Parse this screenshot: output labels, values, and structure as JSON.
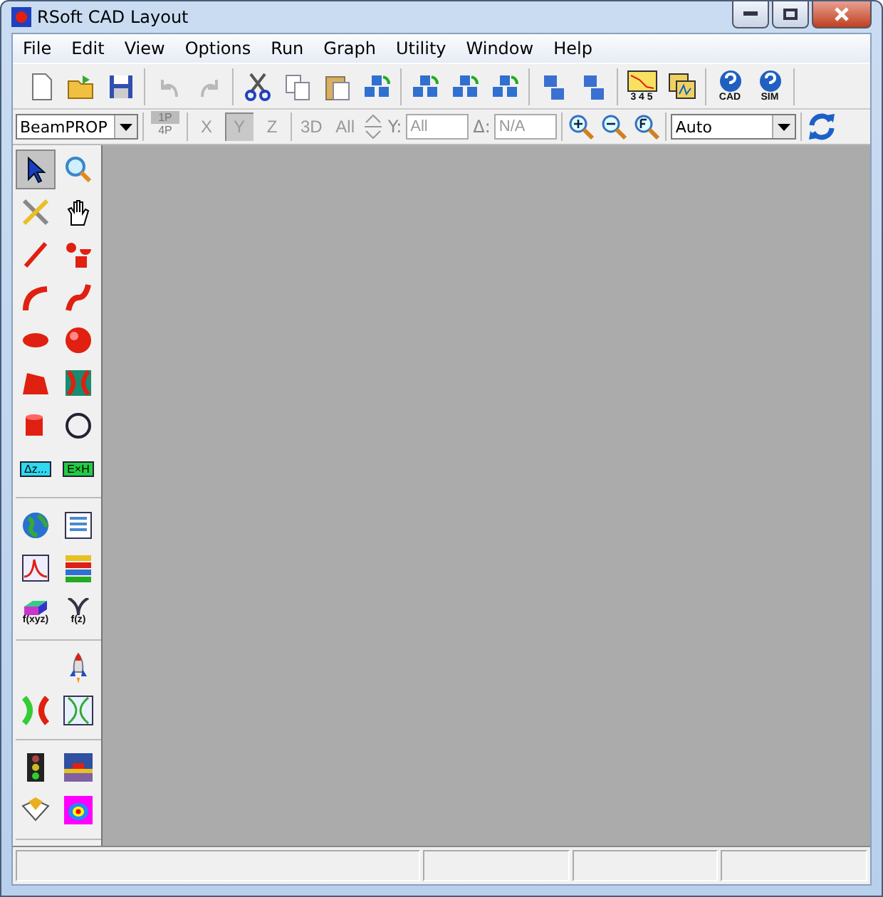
{
  "window": {
    "title": "RSoft CAD Layout"
  },
  "menu": [
    {
      "label": "File"
    },
    {
      "label": "Edit"
    },
    {
      "label": "View"
    },
    {
      "label": "Options"
    },
    {
      "label": "Run"
    },
    {
      "label": "Graph"
    },
    {
      "label": "Utility"
    },
    {
      "label": "Window"
    },
    {
      "label": "Help"
    }
  ],
  "toolbar": [
    [
      {
        "kind": "new",
        "disabled": false
      },
      {
        "kind": "open",
        "disabled": false
      },
      {
        "kind": "save",
        "disabled": false
      }
    ],
    [
      {
        "kind": "undo",
        "disabled": true
      },
      {
        "kind": "redo",
        "disabled": true
      }
    ],
    [
      {
        "kind": "cut",
        "disabled": false
      },
      {
        "kind": "copy",
        "disabled": false
      },
      {
        "kind": "paste",
        "disabled": false
      },
      {
        "kind": "cubes",
        "disabled": false
      }
    ],
    [
      {
        "kind": "cubes",
        "disabled": false
      },
      {
        "kind": "cubes",
        "disabled": false
      },
      {
        "kind": "cubes",
        "disabled": false
      }
    ],
    [
      {
        "kind": "stack",
        "disabled": false
      },
      {
        "kind": "stack",
        "disabled": false
      }
    ],
    [
      {
        "kind": "chart",
        "disabled": false,
        "label": "3 4 5"
      },
      {
        "kind": "windows",
        "disabled": false
      }
    ],
    [
      {
        "kind": "help",
        "disabled": false,
        "label": "CAD"
      },
      {
        "kind": "help",
        "disabled": false,
        "label": "SIM"
      }
    ]
  ],
  "options_bar": {
    "program": "BeamPROP",
    "view_top": "1P",
    "view_bottom": "4P",
    "axes": [
      {
        "label": "X",
        "selected": false
      },
      {
        "label": "Y",
        "selected": true
      },
      {
        "label": "Z",
        "selected": false
      },
      {
        "label": "3D",
        "selected": false
      },
      {
        "label": "All",
        "selected": false
      }
    ],
    "y_label": "Y:",
    "y_value": "All",
    "delta_label": "Δ:",
    "delta_value": "N/A",
    "zoom": "Auto"
  },
  "palette": [
    [
      {
        "kind": "pointer",
        "selected": true
      },
      {
        "kind": "magnifier",
        "selected": false
      },
      {
        "kind": "tools",
        "selected": false
      },
      {
        "kind": "hand",
        "selected": false
      },
      {
        "kind": "line",
        "selected": false
      },
      {
        "kind": "shapes",
        "selected": false
      },
      {
        "kind": "arc",
        "selected": false
      },
      {
        "kind": "scurve",
        "selected": false
      },
      {
        "kind": "lens",
        "selected": false
      },
      {
        "kind": "sphere",
        "selected": false
      },
      {
        "kind": "polygon",
        "selected": false
      },
      {
        "kind": "coupler",
        "selected": false
      },
      {
        "kind": "cylinder",
        "selected": false
      },
      {
        "kind": "ring",
        "selected": false
      },
      {
        "kind": "tag",
        "selected": false,
        "label": "Δz..."
      },
      {
        "kind": "tag",
        "selected": false,
        "label": "E×H"
      }
    ],
    [
      {
        "kind": "globe",
        "selected": false
      },
      {
        "kind": "list",
        "selected": false
      },
      {
        "kind": "plot",
        "selected": false
      },
      {
        "kind": "layers",
        "selected": false
      },
      {
        "kind": "func",
        "selected": false,
        "label": "f(xyz)"
      },
      {
        "kind": "branch",
        "selected": false,
        "label": "f(z)"
      }
    ],
    [
      {
        "kind": "empty"
      },
      {
        "kind": "rocket",
        "selected": false
      },
      {
        "kind": "coupler2",
        "selected": false
      },
      {
        "kind": "fiber",
        "selected": false
      }
    ],
    [
      {
        "kind": "light",
        "selected": false
      },
      {
        "kind": "substrate",
        "selected": false
      },
      {
        "kind": "star",
        "selected": false
      },
      {
        "kind": "mode",
        "selected": false
      }
    ]
  ]
}
